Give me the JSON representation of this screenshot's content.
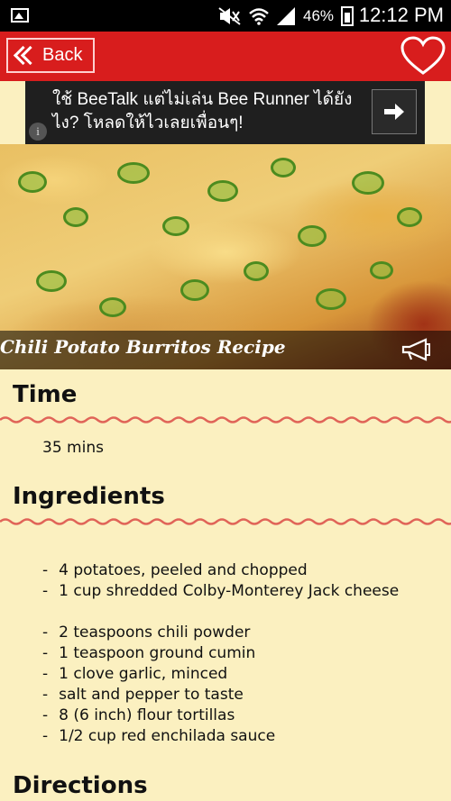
{
  "status_bar": {
    "battery_percent": "46%",
    "time": "12:12 PM",
    "icons": [
      "image-icon",
      "mute-icon",
      "wifi-icon",
      "signal-icon",
      "battery-icon"
    ]
  },
  "app_bar": {
    "back_label": "Back",
    "accent_color": "#d81d1d",
    "favorite_icon": "heart-icon"
  },
  "ad": {
    "text": "ใช้ BeeTalk แต่ไม่เล่น Bee Runner ได้ยังไง? โหลดให้ไวเลยเพื่อนๆ!",
    "info_icon": "i"
  },
  "recipe": {
    "title": "Chili Potato Burritos Recipe",
    "sections": {
      "time_heading": "Time",
      "time_value": "35 mins",
      "ingredients_heading": "Ingredients",
      "directions_heading": "Directions"
    },
    "ingredients": [
      "4 potatoes, peeled and chopped",
      "1 cup shredded Colby-Monterey Jack cheese",
      "",
      "2 teaspoons chili powder",
      "1 teaspoon ground cumin",
      "1 clove garlic, minced",
      "salt and pepper to taste",
      "8 (6 inch) flour tortillas",
      "1/2 cup red enchilada sauce"
    ],
    "bullet": "-"
  }
}
